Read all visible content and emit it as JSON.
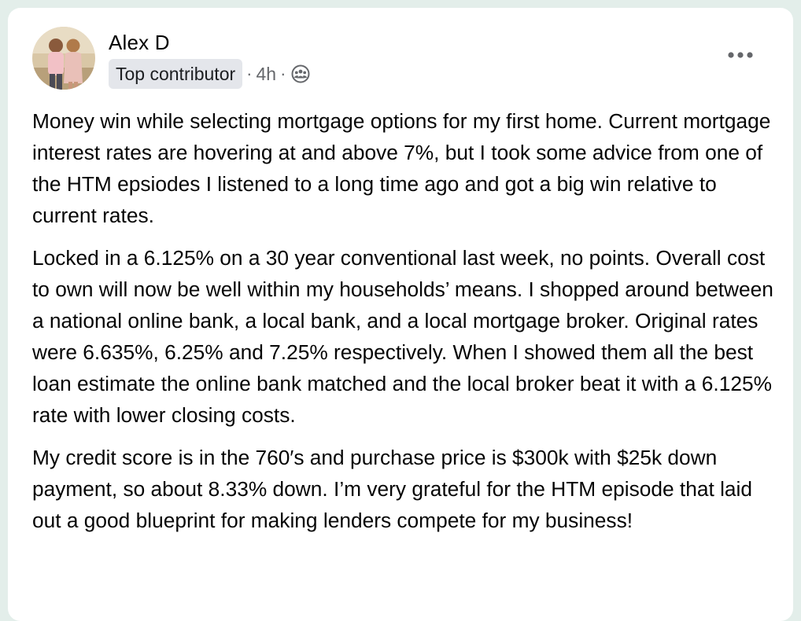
{
  "post": {
    "author": "Alex D",
    "badge": "Top contributor",
    "separator": "·",
    "time": "4h",
    "audience_icon": "group-icon",
    "more_icon": "more-horizontal-icon",
    "paragraphs": [
      "Money win while selecting mortgage options for my first home. Current mortgage interest rates are hovering at and above 7%, but I took some advice from one of the HTM epsiodes I listened to a long time ago and got a big win relative to current rates.",
      "Locked in a 6.125% on a 30 year conventional last week, no points. Overall cost to own will now be well within my households’ means. I shopped around between a national online bank, a local bank, and a local mortgage broker. Original rates were 6.635%, 6.25% and 7.25% respectively. When I showed them all the best loan estimate the online bank matched and the local broker beat it with a 6.125% rate with lower closing costs.",
      "My credit score is in the 760′s and purchase price is $300k with $25k down payment, so about 8.33% down. I’m very grateful for the HTM episode that laid out a good blueprint for making lenders compete for my business!"
    ]
  },
  "colors": {
    "page_background": "#e3eeea",
    "card_background": "#ffffff",
    "text_primary": "#050505",
    "text_secondary": "#65676b",
    "badge_background": "#e4e6eb"
  }
}
